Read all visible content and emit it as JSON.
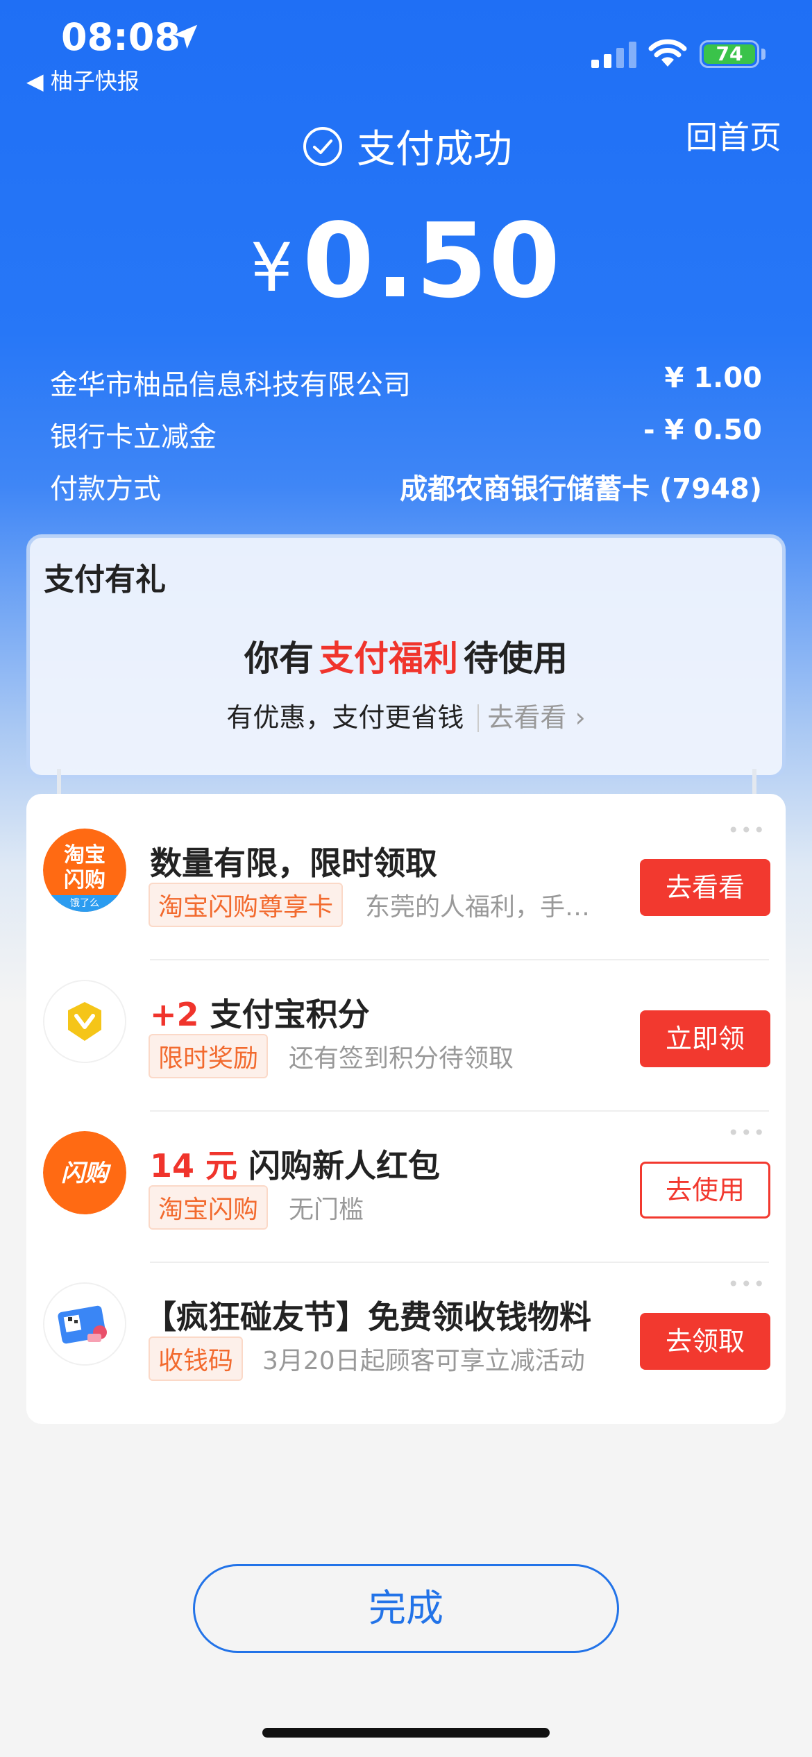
{
  "status_bar": {
    "time": "08:08",
    "back_app": "◀ 柚子快报",
    "battery": "74"
  },
  "header": {
    "title": "支付成功",
    "home": "回首页"
  },
  "amount": {
    "currency": "¥",
    "value": "0.50"
  },
  "details": [
    {
      "label": "金华市柚品信息科技有限公司",
      "value": "¥ 1.00"
    },
    {
      "label": "银行卡立减金",
      "value": "- ¥ 0.50"
    },
    {
      "label": "付款方式",
      "value": "成都农商银行储蓄卡 (7948)"
    }
  ],
  "gift": {
    "title": "支付有礼",
    "main_prefix": "你有",
    "main_highlight": "支付福利",
    "main_suffix": "待使用",
    "sub": "有优惠，支付更省钱",
    "go": "去看看",
    "go_chevron": "›"
  },
  "more_dots": "•••",
  "items": [
    {
      "icon": "taobao-shangou-card-icon",
      "icon_text_1": "淘宝",
      "icon_text_2": "闪购",
      "icon_badge": "饿了么",
      "title_highlight": "",
      "title": "数量有限，限时领取",
      "tag": "淘宝闪购尊享卡",
      "desc": "东莞的人福利，手…",
      "button": "去看看",
      "button_style": "filled"
    },
    {
      "icon": "alipay-points-icon",
      "title_highlight": "+2",
      "title": "支付宝积分",
      "tag": "限时奖励",
      "desc": "还有签到积分待领取",
      "button": "立即领",
      "button_style": "filled"
    },
    {
      "icon": "shangou-icon",
      "icon_text_1": "闪购",
      "title_highlight": "14 元",
      "title": "闪购新人红包",
      "tag": "淘宝闪购",
      "desc": "无门槛",
      "button": "去使用",
      "button_style": "outline"
    },
    {
      "icon": "qr-code-material-icon",
      "title_highlight": "",
      "title": "【疯狂碰友节】免费领收钱物料",
      "tag": "收钱码",
      "desc": "3月20日起顾客可享立减活动",
      "button": "去领取",
      "button_style": "filled"
    }
  ],
  "footer": {
    "done": "完成"
  },
  "colors": {
    "brand_blue": "#1f6ff5",
    "accent_red": "#f2392f",
    "tag_orange": "#f26a2e"
  }
}
